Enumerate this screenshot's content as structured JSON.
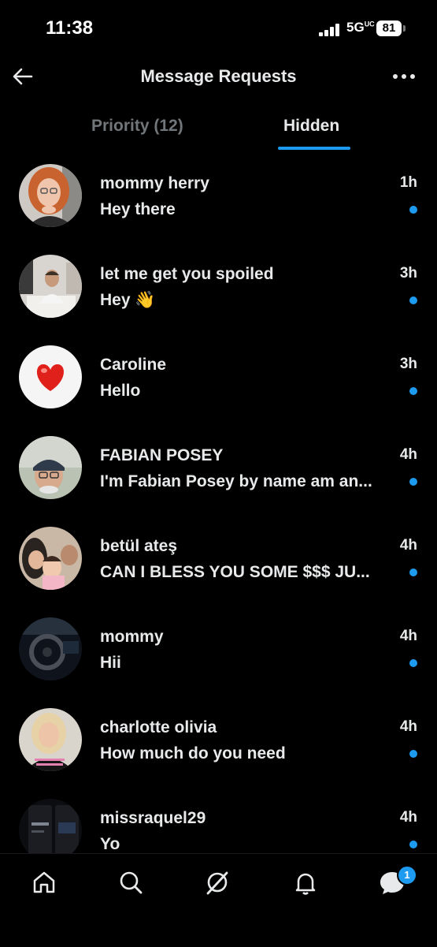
{
  "status_bar": {
    "time": "11:38",
    "network": "5G",
    "network_suffix": "UC",
    "battery": "81"
  },
  "header": {
    "title": "Message Requests",
    "back_icon": "arrow-left-icon",
    "more_icon": "ellipsis-icon"
  },
  "tabs": [
    {
      "label": "Priority (12)",
      "active": false
    },
    {
      "label": "Hidden",
      "active": true
    }
  ],
  "colors": {
    "accent": "#1d9bf0",
    "background": "#000000",
    "text": "#e7e9ea",
    "muted": "#71767b"
  },
  "messages": [
    {
      "name": "mommy herry",
      "preview": "Hey there",
      "time": "1h",
      "unread": true,
      "avatar": "photo-red-hair-woman"
    },
    {
      "name": "let me get you spoiled",
      "preview": "Hey 👋",
      "time": "3h",
      "unread": true,
      "avatar": "photo-man-at-desk"
    },
    {
      "name": "Caroline",
      "preview": "Hello",
      "time": "3h",
      "unread": true,
      "avatar": "red-heart"
    },
    {
      "name": "FABIAN POSEY",
      "preview": "I'm Fabian Posey by name am an...",
      "time": "4h",
      "unread": true,
      "avatar": "photo-older-man-cap"
    },
    {
      "name": "betül ateş",
      "preview": "CAN I BLESS YOU SOME $$$ JU...",
      "time": "4h",
      "unread": true,
      "avatar": "photo-family"
    },
    {
      "name": "mommy",
      "preview": "Hii",
      "time": "4h",
      "unread": true,
      "avatar": "photo-car-interior"
    },
    {
      "name": "charlotte olivia",
      "preview": "How much do you need",
      "time": "4h",
      "unread": true,
      "avatar": "photo-blonde-woman"
    },
    {
      "name": "missraquel29",
      "preview": "Yo",
      "time": "4h",
      "unread": true,
      "avatar": "photo-cash-app-screenshot"
    }
  ],
  "bottom_nav": {
    "items": [
      "home-icon",
      "search-icon",
      "grok-icon",
      "notifications-icon",
      "messages-icon"
    ],
    "messages_badge": "1"
  }
}
